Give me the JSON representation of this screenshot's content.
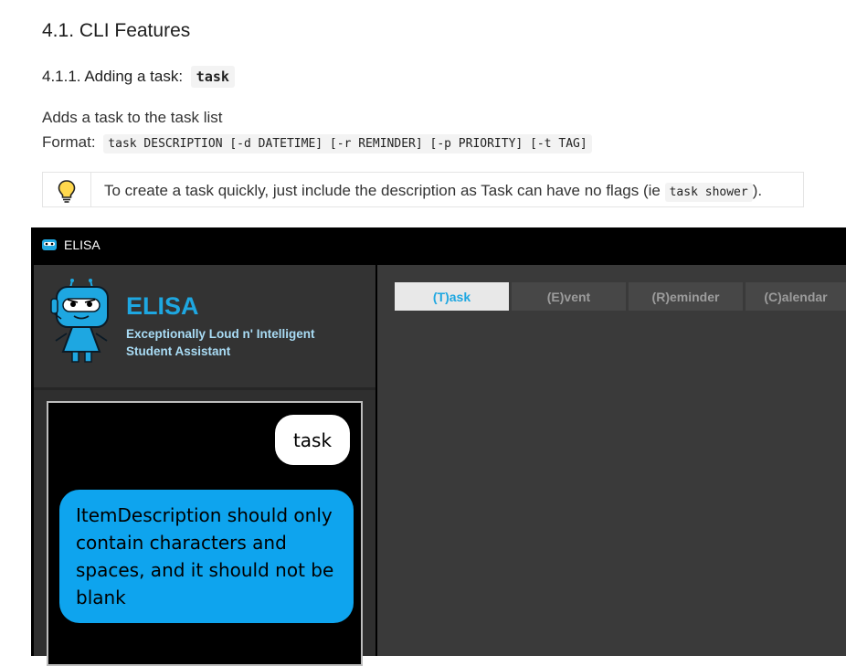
{
  "doc": {
    "section_title": "4.1. CLI Features",
    "subsection_title": "4.1.1. Adding a task:",
    "subsection_code": "task",
    "description": "Adds a task to the task list",
    "format_label": "Format:",
    "format_code": "task DESCRIPTION [-d DATETIME] [-r REMINDER] [-p PRIORITY] [-t TAG]",
    "tip": {
      "icon": "lightbulb-icon",
      "text_before": "To create a task quickly, just include the description as Task can have no flags (ie",
      "code": "task shower",
      "text_after": ")."
    }
  },
  "window": {
    "title": "ELISA",
    "app_name": "ELISA",
    "tagline": "Exceptionally Loud n' Intelligent Student Assistant",
    "chat": {
      "user_message": "task",
      "bot_message": "ItemDescription should only contain characters and spaces, and it should not be blank"
    },
    "tabs": [
      {
        "label": "(T)ask",
        "active": true
      },
      {
        "label": "(E)vent",
        "active": false
      },
      {
        "label": "(R)eminder",
        "active": false
      },
      {
        "label": "(C)alendar",
        "active": false
      }
    ]
  },
  "colors": {
    "accent": "#1ea7e1",
    "bot_bubble": "#0ea4ee",
    "tagline": "#a9dcf5",
    "pane_bg": "#3a3a3a"
  }
}
